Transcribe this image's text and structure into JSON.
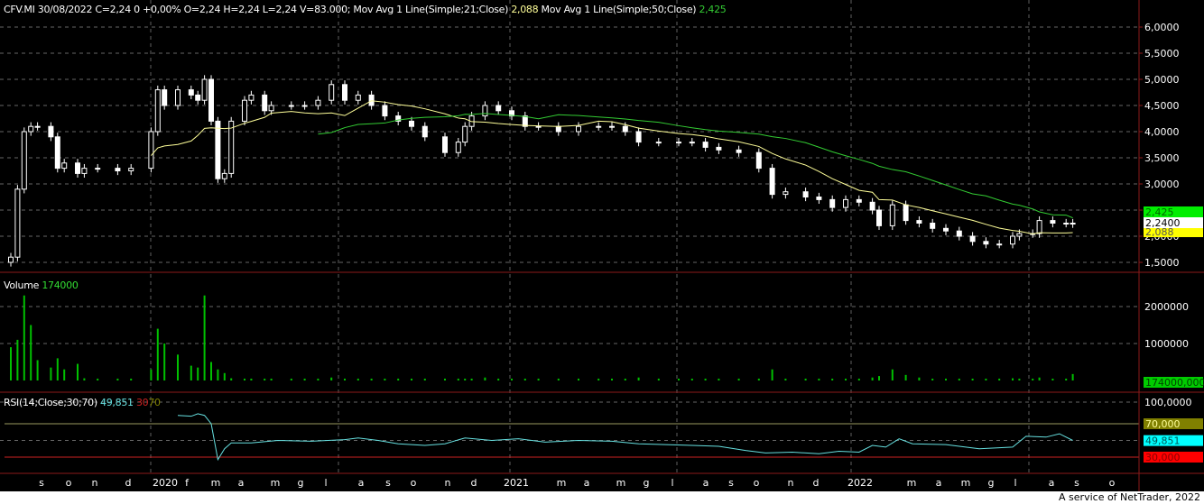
{
  "header": {
    "quote": "CFV.MI 30/08/2022 C=2,24 0 +0,00% O=2,24 H=2,24 L=2,24 V=83.000;",
    "ma21_label": "Mov Avg 1 Line(Simple;21;Close)",
    "ma21_value": "2,088",
    "ma50_label": "Mov Avg 1 Line(Simple;50;Close)",
    "ma50_value": "2,425"
  },
  "volume_header": {
    "label": "Volume",
    "value": "174000"
  },
  "rsi_header": {
    "label": "RSI(14;Close;30;70)",
    "value": "49,851",
    "low": "30",
    "high": "70"
  },
  "price_axis": {
    "ticks": [
      "6,0000",
      "5,5000",
      "5,0000",
      "4,5000",
      "4,0000",
      "3,5000",
      "3,0000",
      "2,5000",
      "2,0000",
      "1,5000"
    ],
    "badges": {
      "ma50": "2,425",
      "last": "2,2400",
      "ma21": "2,088"
    }
  },
  "volume_axis": {
    "ticks": [
      "2000000",
      "1000000"
    ],
    "badge": "174000,000"
  },
  "rsi_axis": {
    "ticks": [
      "100,0000"
    ],
    "badges": {
      "upper": "70,000",
      "value": "49,851",
      "lower": "30,000"
    }
  },
  "x_axis": {
    "labels": [
      "s",
      "o",
      "n",
      "d",
      "2020",
      "f",
      "m",
      "a",
      "m",
      "g",
      "l",
      "a",
      "s",
      "o",
      "n",
      "d",
      "2021",
      "m",
      "a",
      "m",
      "g",
      "l",
      "a",
      "s",
      "o",
      "n",
      "d",
      "2022",
      "m",
      "a",
      "m",
      "g",
      "l",
      "a",
      "s",
      "o"
    ]
  },
  "footer": "A service of NetTrader, 2022",
  "colors": {
    "ma21": "#ffff99",
    "ma50": "#33cc33",
    "volume": "#00c000",
    "rsi": "#66e0e0",
    "upper": "#808000",
    "lower": "#ff0000",
    "grid": "#888888",
    "frame": "#8b1a1a"
  },
  "chart_data": {
    "type": "candlestick",
    "title": "CFV.MI",
    "week": [
      0,
      1,
      2,
      3,
      4,
      6,
      7,
      8,
      10,
      11,
      13,
      16,
      18,
      21,
      22,
      23,
      25,
      27,
      28,
      29,
      30,
      31,
      32,
      33,
      35,
      36,
      38,
      39,
      42,
      44,
      46,
      48,
      50,
      52,
      54,
      56,
      58,
      60,
      62,
      65,
      67,
      68,
      69,
      71,
      73,
      75,
      77,
      79,
      82,
      85,
      88,
      90,
      92,
      94,
      97,
      100,
      102,
      104,
      106,
      109,
      112,
      114,
      116,
      119,
      121,
      123,
      125,
      127,
      129,
      130,
      132,
      134,
      136,
      138,
      140,
      142,
      144,
      146,
      148,
      150,
      151,
      153,
      154,
      156,
      158,
      159
    ],
    "close": [
      1.6,
      2.9,
      4.0,
      4.1,
      4.1,
      3.9,
      3.3,
      3.4,
      3.2,
      3.3,
      3.3,
      3.25,
      3.3,
      4.0,
      4.8,
      4.5,
      4.8,
      4.7,
      4.6,
      5.0,
      4.2,
      3.1,
      3.2,
      4.2,
      4.6,
      4.7,
      4.4,
      4.5,
      4.5,
      4.5,
      4.6,
      4.9,
      4.6,
      4.7,
      4.5,
      4.3,
      4.2,
      4.1,
      3.9,
      3.6,
      3.8,
      4.1,
      4.3,
      4.5,
      4.4,
      4.3,
      4.1,
      4.1,
      4.0,
      4.1,
      4.1,
      4.1,
      4.0,
      3.8,
      3.8,
      3.8,
      3.8,
      3.7,
      3.65,
      3.6,
      3.3,
      2.8,
      2.85,
      2.75,
      2.7,
      2.55,
      2.7,
      2.65,
      2.5,
      2.2,
      2.6,
      2.3,
      2.25,
      2.15,
      2.1,
      2.0,
      1.9,
      1.85,
      1.85,
      2.0,
      2.05,
      2.05,
      2.3,
      2.25,
      2.25,
      2.24
    ],
    "volume": [
      900000,
      1100000,
      2300000,
      1500000,
      550000,
      350000,
      600000,
      300000,
      450000,
      60000,
      50000,
      50000,
      50000,
      300000,
      1400000,
      1000000,
      700000,
      400000,
      350000,
      2300000,
      500000,
      300000,
      200000,
      60000,
      50000,
      50000,
      50000,
      50000,
      50000,
      50000,
      50000,
      80000,
      50000,
      50000,
      50000,
      50000,
      50000,
      50000,
      50000,
      50000,
      50000,
      50000,
      50000,
      80000,
      50000,
      50000,
      50000,
      50000,
      50000,
      50000,
      50000,
      50000,
      50000,
      80000,
      50000,
      50000,
      50000,
      50000,
      50000,
      50000,
      50000,
      300000,
      50000,
      50000,
      50000,
      50000,
      50000,
      50000,
      80000,
      120000,
      300000,
      150000,
      80000,
      50000,
      50000,
      50000,
      50000,
      50000,
      50000,
      60000,
      50000,
      50000,
      80000,
      50000,
      50000,
      174000
    ],
    "rsi": [
      [
        25,
        80
      ],
      [
        27,
        79
      ],
      [
        28,
        82
      ],
      [
        29,
        80
      ],
      [
        30,
        70
      ],
      [
        31,
        27
      ],
      [
        32,
        40
      ],
      [
        33,
        47
      ],
      [
        36,
        47
      ],
      [
        40,
        50
      ],
      [
        45,
        49
      ],
      [
        50,
        51
      ],
      [
        52,
        53
      ],
      [
        55,
        50
      ],
      [
        58,
        46
      ],
      [
        62,
        44
      ],
      [
        65,
        46
      ],
      [
        68,
        53
      ],
      [
        72,
        50
      ],
      [
        76,
        52
      ],
      [
        80,
        48
      ],
      [
        85,
        50
      ],
      [
        90,
        49
      ],
      [
        94,
        46
      ],
      [
        98,
        45
      ],
      [
        102,
        44
      ],
      [
        106,
        43
      ],
      [
        110,
        38
      ],
      [
        113,
        35
      ],
      [
        117,
        36
      ],
      [
        121,
        34
      ],
      [
        124,
        37
      ],
      [
        127,
        36
      ],
      [
        129,
        44
      ],
      [
        131,
        42
      ],
      [
        133,
        52
      ],
      [
        135,
        46
      ],
      [
        140,
        45
      ],
      [
        145,
        40
      ],
      [
        150,
        42
      ],
      [
        152,
        55
      ],
      [
        155,
        54
      ],
      [
        157,
        58
      ],
      [
        159,
        50
      ]
    ],
    "ma_periods_weeks": [
      21,
      50
    ],
    "ylim": [
      1.5,
      6.0
    ],
    "volume_ylim": [
      0,
      2500000
    ],
    "rsi_ylim": [
      0,
      100
    ],
    "rsi_levels": [
      30,
      70
    ]
  }
}
